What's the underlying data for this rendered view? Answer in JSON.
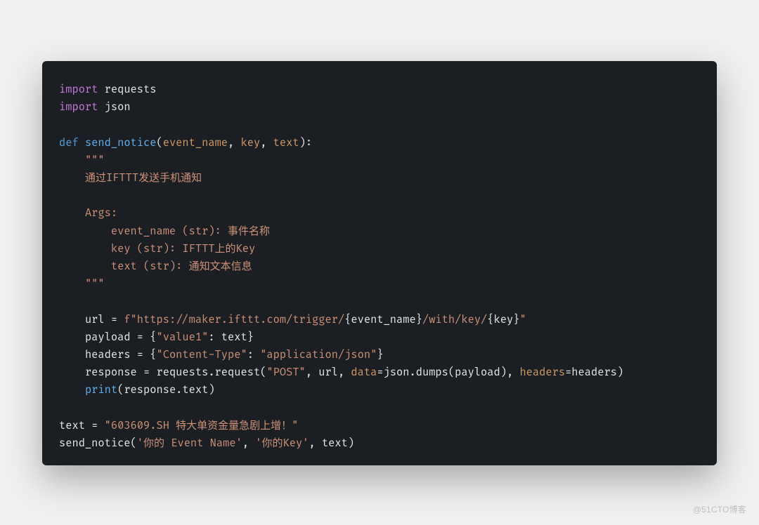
{
  "code": {
    "l1_import": "import",
    "l1_mod": "requests",
    "l2_import": "import",
    "l2_mod": "json",
    "l4_def": "def",
    "l4_fn": "send_notice",
    "l4_p1": "event_name",
    "l4_p2": "key",
    "l4_p3": "text",
    "l5_tq": "\"\"\"",
    "l6": "通过IFTTT发送手机通知",
    "l8": "Args:",
    "l9": "event_name (str): 事件名称",
    "l10": "key (str): IFTTT上的Key",
    "l11": "text (str): 通知文本信息",
    "l12_tq": "\"\"\"",
    "l14_url": "url = ",
    "l14_f": "f\"https://maker.ifttt.com/trigger/",
    "l14_b1o": "{",
    "l14_ev": "event_name",
    "l14_b1c": "}",
    "l14_mid": "/with/key/",
    "l14_b2o": "{",
    "l14_key": "key",
    "l14_b2c": "}",
    "l14_end": "\"",
    "l15_l": "payload = {",
    "l15_s": "\"value1\"",
    "l15_r": ": text}",
    "l16_l": "headers = {",
    "l16_s1": "\"Content-Type\"",
    "l16_m": ": ",
    "l16_s2": "\"application/json\"",
    "l16_r": "}",
    "l17_a": "response = requests.request(",
    "l17_s": "\"POST\"",
    "l17_b": ", url, ",
    "l17_d": "data",
    "l17_c": "=json.dumps(payload), ",
    "l17_h": "headers",
    "l17_e": "=headers)",
    "l18_p": "print",
    "l18_r": "(response.text)",
    "l20_a": "text = ",
    "l20_s": "\"603609.SH 特大单资金量急剧上增！\"",
    "l21_a": "send_notice(",
    "l21_s1": "'你的 Event Name'",
    "l21_c1": ", ",
    "l21_s2": "'你的Key'",
    "l21_c2": ", text)"
  },
  "watermark": "@51CTO博客"
}
